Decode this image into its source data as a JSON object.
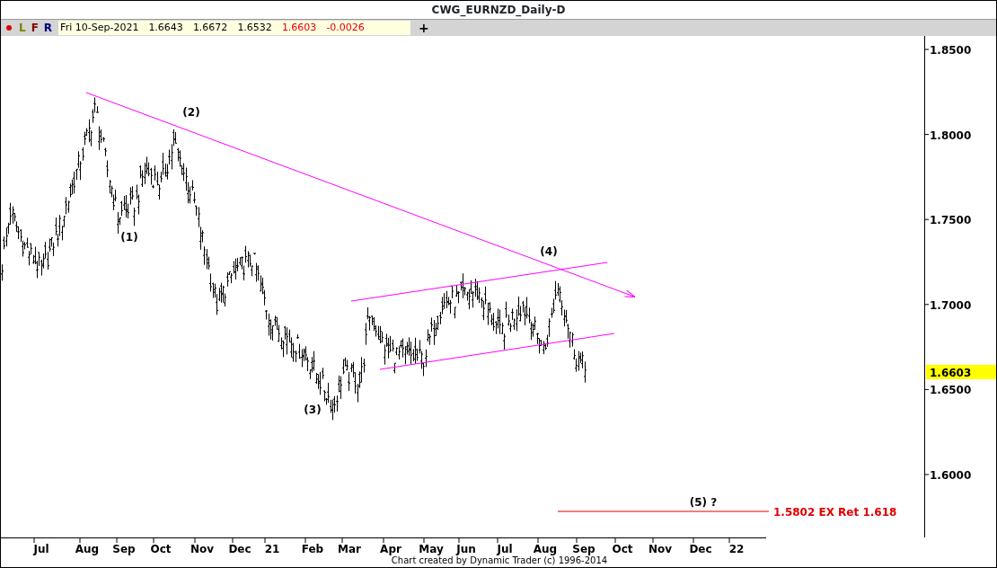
{
  "window": {
    "title": "CWG_EURNZD_Daily-D"
  },
  "toolbar": {
    "buttons": [
      {
        "label": "L",
        "kind": "layout"
      },
      {
        "label": "F",
        "kind": "format"
      },
      {
        "label": "R",
        "kind": "refresh"
      }
    ],
    "quote": {
      "date": "Fri 10-Sep-2021",
      "open": "1.6643",
      "high": "1.6672",
      "low": "1.6532",
      "close": "1.6603",
      "change": "-0.0026"
    },
    "add_button": "+"
  },
  "chart": {
    "price_axis": {
      "ticks": [
        "1.8500",
        "1.8000",
        "1.7500",
        "1.7000",
        "1.6500",
        "1.6000"
      ],
      "last_price": "1.6603"
    },
    "time_axis": {
      "labels": [
        "Jul",
        "Aug",
        "Sep",
        "Oct",
        "Nov",
        "Dec",
        "21",
        "Feb",
        "Mar",
        "Apr",
        "May",
        "Jun",
        "Jul",
        "Aug",
        "Sep",
        "Oct",
        "Nov",
        "Dec",
        "22"
      ]
    },
    "wave_labels": [
      "(2)",
      "(1)",
      "(3)",
      "(4)",
      "(5) ?"
    ],
    "target": {
      "label": "1.5802 EX Ret 1.618"
    }
  },
  "footer": "Chart created by Dynamic Trader  (c) 1996-2014"
}
